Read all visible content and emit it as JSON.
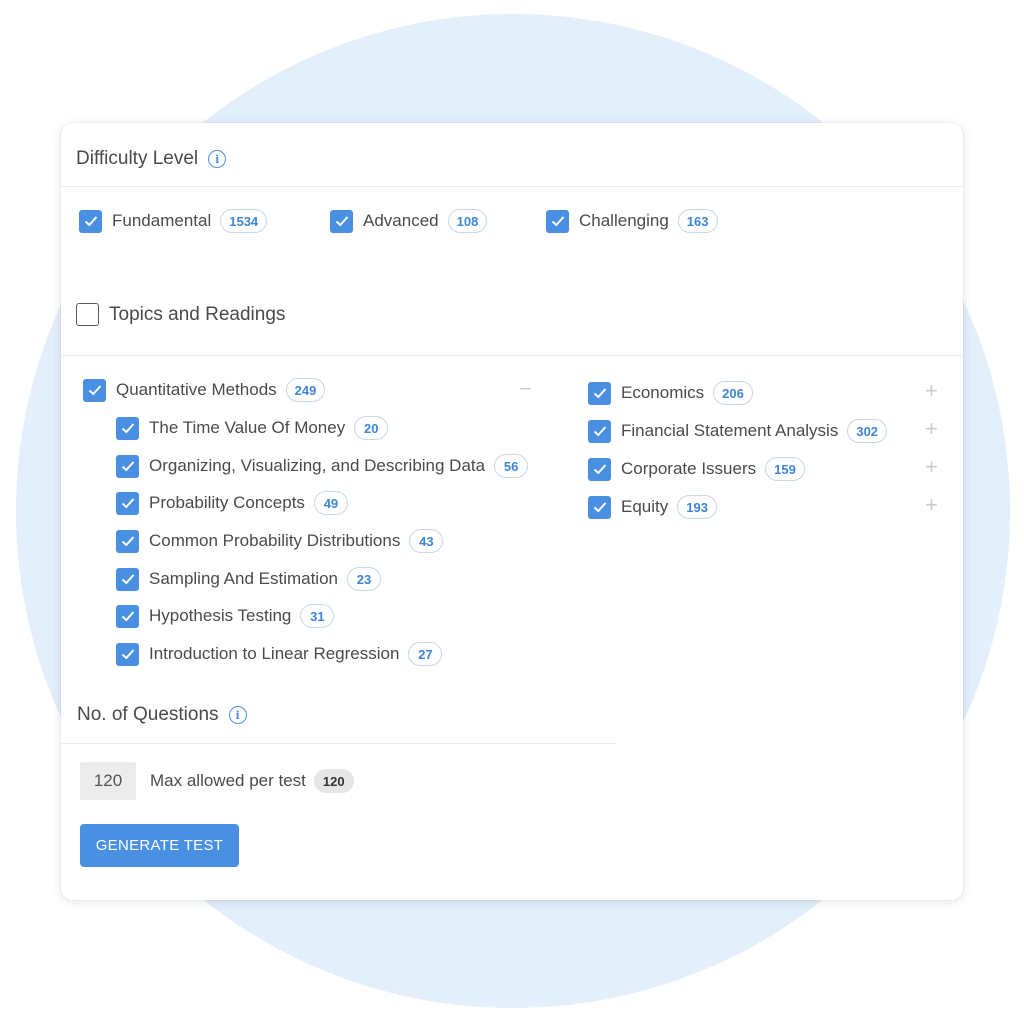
{
  "difficulty": {
    "title": "Difficulty Level",
    "info_icon": "info-icon",
    "levels": [
      {
        "label": "Fundamental",
        "count": "1534",
        "checked": true
      },
      {
        "label": "Advanced",
        "count": "108",
        "checked": true
      },
      {
        "label": "Challenging",
        "count": "163",
        "checked": true
      }
    ]
  },
  "topics": {
    "title": "Topics and Readings",
    "checked": false,
    "left": {
      "label": "Quantitative Methods",
      "count": "249",
      "checked": true,
      "expander": "−",
      "children": [
        {
          "label": "The Time Value Of Money",
          "count": "20",
          "checked": true
        },
        {
          "label": "Organizing, Visualizing, and Describing Data",
          "count": "56",
          "checked": true
        },
        {
          "label": "Probability Concepts",
          "count": "49",
          "checked": true
        },
        {
          "label": "Common Probability Distributions",
          "count": "43",
          "checked": true
        },
        {
          "label": "Sampling And Estimation",
          "count": "23",
          "checked": true
        },
        {
          "label": "Hypothesis Testing",
          "count": "31",
          "checked": true
        },
        {
          "label": "Introduction to Linear Regression",
          "count": "27",
          "checked": true
        }
      ]
    },
    "right": [
      {
        "label": "Economics",
        "count": "206",
        "checked": true,
        "expander": "+"
      },
      {
        "label": "Financial Statement Analysis",
        "count": "302",
        "checked": true,
        "expander": "+"
      },
      {
        "label": "Corporate Issuers",
        "count": "159",
        "checked": true,
        "expander": "+"
      },
      {
        "label": "Equity",
        "count": "193",
        "checked": true,
        "expander": "+"
      }
    ]
  },
  "questions": {
    "title": "No. of Questions",
    "value": "120",
    "max_label": "Max allowed per test",
    "max_value": "120"
  },
  "actions": {
    "generate_label": "GENERATE TEST"
  },
  "colors": {
    "accent": "#4a90e2",
    "background_circle": "#e3effb",
    "count_text": "#3d86d6"
  }
}
